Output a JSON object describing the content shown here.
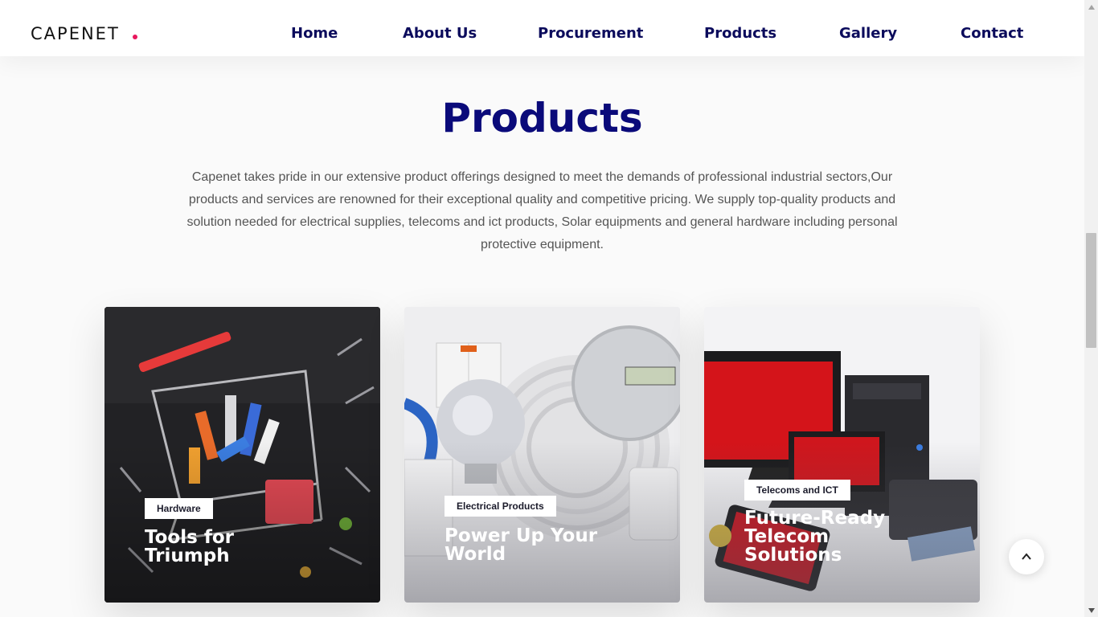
{
  "header": {
    "logo": "CAPENET",
    "nav": [
      "Home",
      "About Us",
      "Procurement",
      "Products",
      "Gallery",
      "Contact"
    ]
  },
  "section": {
    "title": "Products",
    "intro": "Capenet takes pride in our extensive product offerings designed to meet the demands of professional industrial sectors,Our products and services are renowned for their exceptional quality and competitive pricing. We supply top-quality products and solution needed for electrical supplies, telecoms and ict products, Solar equipments and general hardware including personal protective equipment."
  },
  "cards": [
    {
      "tag": "Hardware",
      "title": "Tools for Triumph"
    },
    {
      "tag": "Electrical Products",
      "title": "Power Up Your World"
    },
    {
      "tag": "Telecoms and ICT",
      "title": "Future-Ready Telecom Solutions"
    }
  ],
  "colors": {
    "nav": "#0b0b5c",
    "title": "#0a0a7a",
    "logo_dot": "#e8175d"
  },
  "icons": {
    "scroll_top": "chevron-up-icon"
  }
}
